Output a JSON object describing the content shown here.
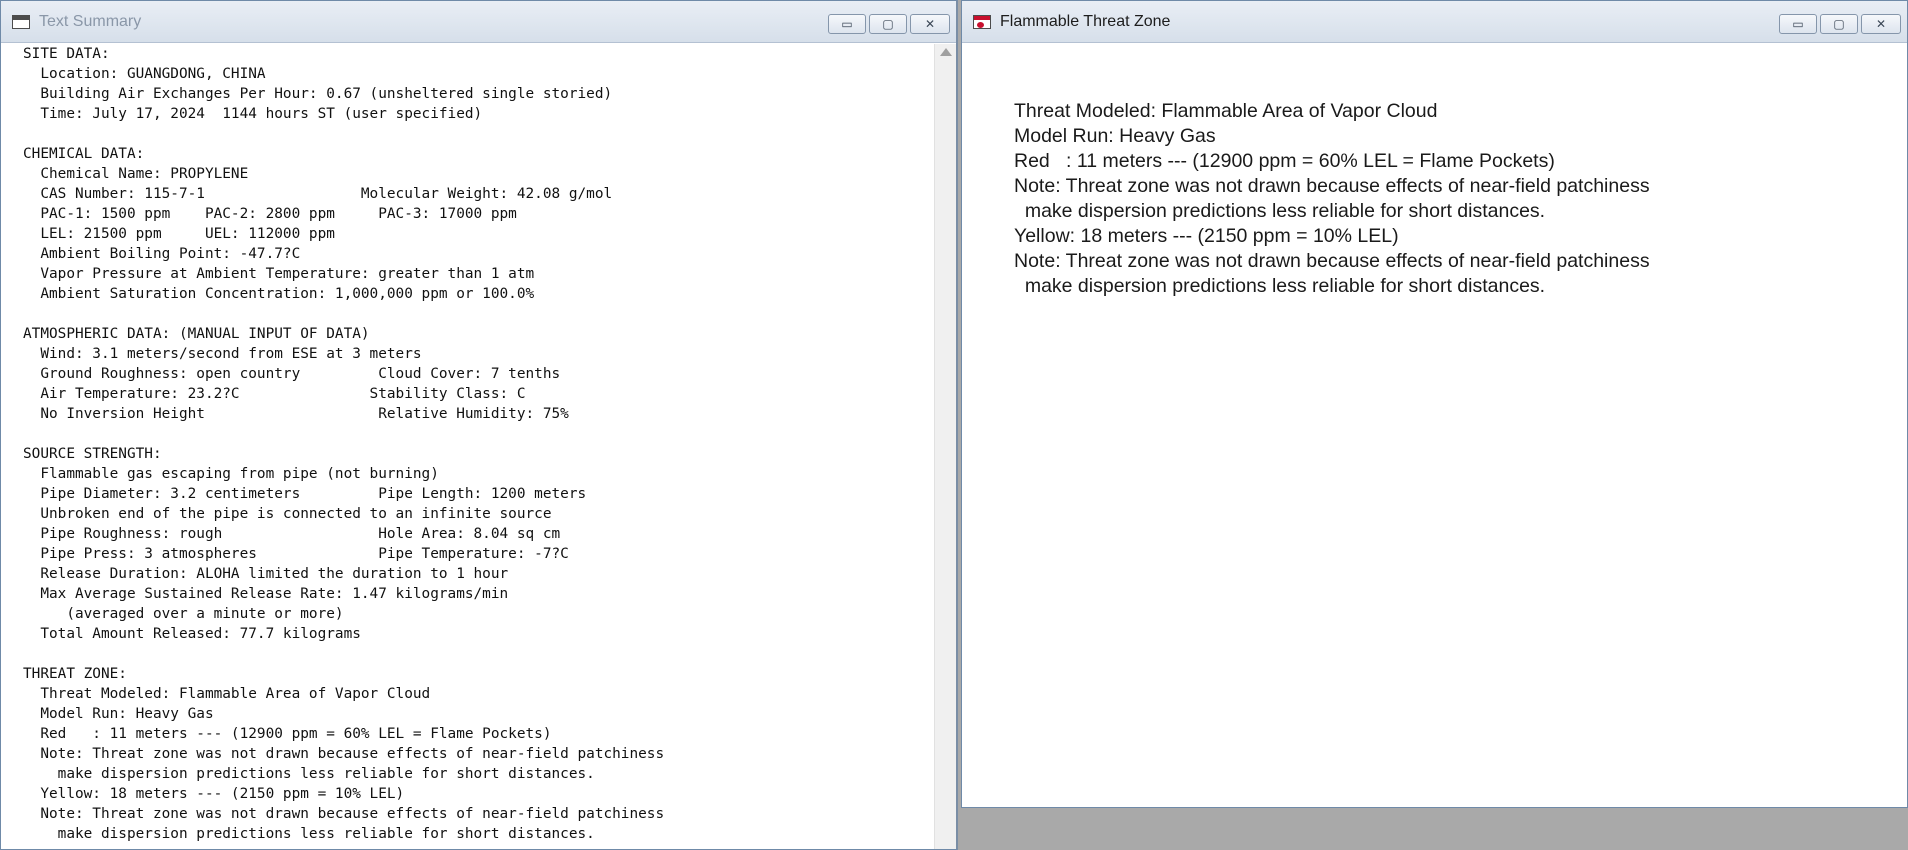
{
  "text_summary_window": {
    "title": "Text Summary",
    "controls": {
      "minimize": "▭",
      "maximize": "▢",
      "close": "✕"
    },
    "lines": [
      "SITE DATA:",
      "  Location: GUANGDONG, CHINA",
      "  Building Air Exchanges Per Hour: 0.67 (unsheltered single storied)",
      "  Time: July 17, 2024  1144 hours ST (user specified)",
      "",
      "CHEMICAL DATA:",
      "  Chemical Name: PROPYLENE",
      "  CAS Number: 115-7-1                  Molecular Weight: 42.08 g/mol",
      "  PAC-1: 1500 ppm    PAC-2: 2800 ppm     PAC-3: 17000 ppm",
      "  LEL: 21500 ppm     UEL: 112000 ppm",
      "  Ambient Boiling Point: -47.7?C",
      "  Vapor Pressure at Ambient Temperature: greater than 1 atm",
      "  Ambient Saturation Concentration: 1,000,000 ppm or 100.0%",
      "",
      "ATMOSPHERIC DATA: (MANUAL INPUT OF DATA)",
      "  Wind: 3.1 meters/second from ESE at 3 meters",
      "  Ground Roughness: open country         Cloud Cover: 7 tenths",
      "  Air Temperature: 23.2?C               Stability Class: C",
      "  No Inversion Height                    Relative Humidity: 75%",
      "",
      "SOURCE STRENGTH:",
      "  Flammable gas escaping from pipe (not burning)",
      "  Pipe Diameter: 3.2 centimeters         Pipe Length: 1200 meters",
      "  Unbroken end of the pipe is connected to an infinite source",
      "  Pipe Roughness: rough                  Hole Area: 8.04 sq cm",
      "  Pipe Press: 3 atmospheres              Pipe Temperature: -7?C",
      "  Release Duration: ALOHA limited the duration to 1 hour",
      "  Max Average Sustained Release Rate: 1.47 kilograms/min",
      "     (averaged over a minute or more)",
      "  Total Amount Released: 77.7 kilograms",
      "",
      "THREAT ZONE:",
      "  Threat Modeled: Flammable Area of Vapor Cloud",
      "  Model Run: Heavy Gas",
      "  Red   : 11 meters --- (12900 ppm = 60% LEL = Flame Pockets)",
      "  Note: Threat zone was not drawn because effects of near-field patchiness",
      "    make dispersion predictions less reliable for short distances.",
      "  Yellow: 18 meters --- (2150 ppm = 10% LEL)",
      "  Note: Threat zone was not drawn because effects of near-field patchiness",
      "    make dispersion predictions less reliable for short distances."
    ]
  },
  "threat_zone_window": {
    "title": "Flammable Threat Zone",
    "controls": {
      "minimize": "▭",
      "maximize": "▢",
      "close": "✕"
    },
    "lines": [
      "Threat Modeled: Flammable Area of Vapor Cloud",
      "Model Run: Heavy Gas",
      "Red   : 11 meters --- (12900 ppm = 60% LEL = Flame Pockets)",
      "Note: Threat zone was not drawn because effects of near-field patchiness",
      "  make dispersion predictions less reliable for short distances.",
      "Yellow: 18 meters --- (2150 ppm = 10% LEL)",
      "Note: Threat zone was not drawn because effects of near-field patchiness",
      "  make dispersion predictions less reliable for short distances."
    ]
  }
}
